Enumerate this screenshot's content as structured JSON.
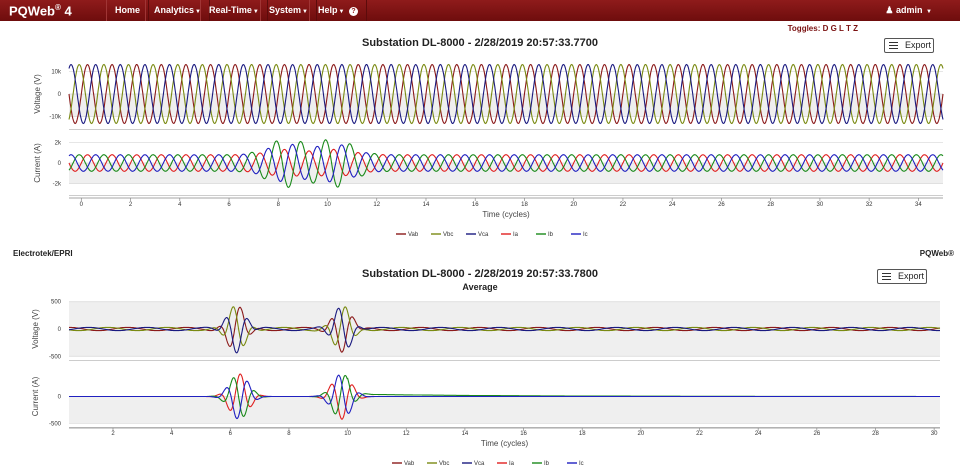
{
  "navbar": {
    "brand": "PQWeb",
    "brand_sup": "®",
    "brand_version": "4",
    "items": [
      {
        "label": "Home"
      },
      {
        "label": "Analytics"
      },
      {
        "label": "Real-Time"
      },
      {
        "label": "System"
      },
      {
        "label": "Help"
      }
    ],
    "user": "admin"
  },
  "toggles": "Toggles: D G L T Z",
  "export_label": "Export",
  "footer": {
    "left": "Electrotek/EPRI",
    "right": "PQWeb®"
  },
  "colors": {
    "Vab": "#8b1a1a",
    "Vbc": "#7a8a12",
    "Vca": "#1a1a80",
    "Ia": "#e02020",
    "Ib": "#1a8a1a",
    "Ic": "#2020c0",
    "navbar": "#7a1212"
  },
  "chart_data": [
    {
      "type": "line",
      "title": "Substation DL-8000 - 2/28/2019 20:57:33.7700",
      "subtitle": "",
      "xlabel": "Time (cycles)",
      "xlim": [
        -0.5,
        35
      ],
      "xticks": [
        "0",
        "2",
        "4",
        "6",
        "8",
        "10",
        "12",
        "14",
        "16",
        "18",
        "20",
        "22",
        "24",
        "26",
        "28",
        "30",
        "32",
        "34"
      ],
      "panels": [
        {
          "ylabel": "Voltage (V)",
          "ylim": [
            -15000,
            15000
          ],
          "yticks": [
            "10k",
            "0",
            "-10k"
          ],
          "yvals": [
            10000,
            0,
            -10000
          ],
          "series": [
            "Vab",
            "Vbc",
            "Vca"
          ],
          "amplitude": 13000
        },
        {
          "ylabel": "Current (A)",
          "ylim": [
            -3000,
            3000
          ],
          "yticks": [
            "2k",
            "0",
            "-2k"
          ],
          "yvals": [
            2000,
            0,
            -2000
          ],
          "series": [
            "Ia",
            "Ib",
            "Ic"
          ],
          "amplitude": 800,
          "fault_peak": 2600
        }
      ],
      "legend": [
        "Vab",
        "Vbc",
        "Vca",
        "Ia",
        "Ib",
        "Ic"
      ]
    },
    {
      "type": "line",
      "title": "Substation DL-8000 - 2/28/2019 20:57:33.7800",
      "subtitle": "Average",
      "xlabel": "Time (cycles)",
      "xlim": [
        0.5,
        30.2
      ],
      "xticks": [
        "2",
        "4",
        "6",
        "8",
        "10",
        "12",
        "14",
        "16",
        "18",
        "20",
        "22",
        "24",
        "26",
        "28",
        "30"
      ],
      "panels": [
        {
          "ylabel": "Voltage (V)",
          "ylim": [
            -550,
            550
          ],
          "yticks": [
            "500",
            "0",
            "-500"
          ],
          "yvals": [
            500,
            0,
            -500
          ],
          "series": [
            "Vab",
            "Vbc",
            "Vca"
          ],
          "amplitude": 30,
          "fault_peak": 480
        },
        {
          "ylabel": "Current (A)",
          "ylim": [
            -550,
            550
          ],
          "yticks": [
            "0",
            "-500"
          ],
          "yvals": [
            0,
            -500
          ],
          "series": [
            "Ia",
            "Ib",
            "Ic"
          ],
          "amplitude": 5,
          "fault_peak": 530
        }
      ],
      "legend": [
        "Vab",
        "Vbc",
        "Vca",
        "Ia",
        "Ib",
        "Ic"
      ]
    }
  ]
}
